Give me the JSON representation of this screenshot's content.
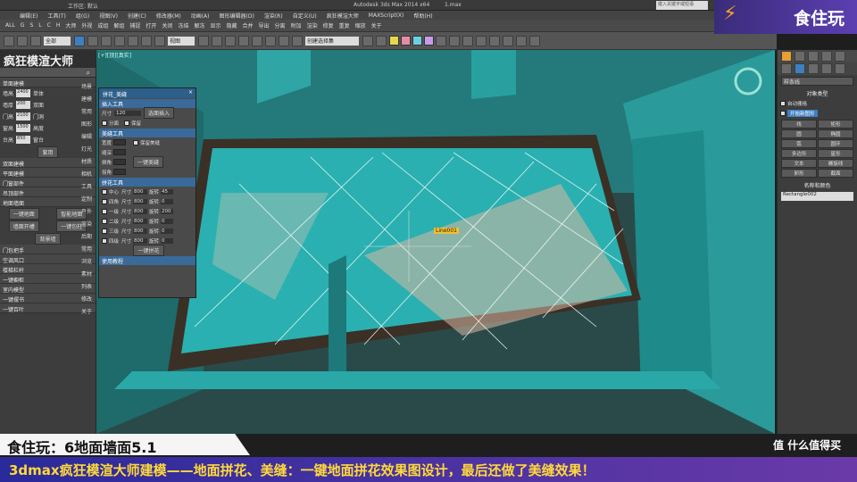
{
  "window": {
    "title": "Autodesk 3ds Max 2014 x64",
    "workspace": "工作区: 默认",
    "file": "1.max",
    "search_placeholder": "键入关键字或短语"
  },
  "menu": [
    "编辑(E)",
    "工具(T)",
    "组(G)",
    "视图(V)",
    "创建(C)",
    "修改器(M)",
    "动画(A)",
    "图形编辑器(D)",
    "渲染(R)",
    "自定义(U)",
    "疯狂模渲大师",
    "MAXScript(X)",
    "帮助(H)"
  ],
  "toolbar1": [
    "ALL",
    "G",
    "S",
    "L",
    "C",
    "H",
    "大师",
    "外视",
    "成组",
    "解组",
    "捕捉",
    "打开",
    "关闭",
    "冻结",
    "解冻",
    "显示",
    "隐藏",
    "合并",
    "导出",
    "分离",
    "附加",
    "渲染",
    "修复",
    "重复",
    "缩放",
    "关于"
  ],
  "toolbar2": {
    "selection_filter": "全部",
    "view": "视图",
    "named_set": "创建选择集"
  },
  "viewport": {
    "label": "[+][顶][真实]",
    "object_label": "Line001"
  },
  "left_panel": {
    "title": "疯狂模渲大师",
    "sections": [
      "单面建模",
      "双面建模",
      "平面建模",
      "门窗部件",
      "吊顶部件",
      "地面墙面",
      "门包把手",
      "空调风口",
      "楼梯栏杆",
      "一键橱柜",
      "室内模型",
      "一键摆书",
      "一键百叶"
    ],
    "fields": {
      "wall_h": "2400",
      "wall_h_label": "墙高",
      "thick": "200",
      "thick_label": "墙厚",
      "door_h": "2100",
      "door_h_label": "门高",
      "window_h": "1500",
      "window_h_label": "窗高",
      "sill": "850",
      "sill_label": "台高",
      "single": "单体",
      "double": "双面",
      "door": "门洞",
      "height": "高度",
      "sill_b": "窗台"
    },
    "apply_label": "套用",
    "buttons": [
      "一键地面",
      "智能地面",
      "墙面开槽",
      "一键包柱",
      "背景墙"
    ],
    "categories": [
      "场景",
      "建模",
      "常用",
      "图形",
      "编辑",
      "灯光",
      "材质",
      "相机",
      "工具",
      "定制",
      "户外",
      "渲染",
      "后期",
      "常用",
      "浏览",
      "素材",
      "列表",
      "修改",
      "关于"
    ]
  },
  "dialog": {
    "title": "拼花_美缝",
    "sec1": "插入工具",
    "wall_label": "尺寸",
    "wall_val": "120",
    "select_btn": "选面插入",
    "opt1": "分面",
    "opt2": "保留",
    "sec2": "美缝工具",
    "sec2_rows": [
      "宽度",
      "缝深",
      "倒角",
      "拐角"
    ],
    "keep": "保留美缝",
    "seam_btn": "一键美缝",
    "sec3": "拼花工具",
    "sec3_rows": [
      {
        "name": "中心",
        "size": "800",
        "rot": "45"
      },
      {
        "name": "四角",
        "size": "800",
        "rot": "0"
      },
      {
        "name": "一级",
        "size": "800",
        "rot": "200"
      },
      {
        "name": "二级",
        "size": "800",
        "rot": "0"
      },
      {
        "name": "三级",
        "size": "800",
        "rot": "0"
      },
      {
        "name": "四级",
        "size": "800",
        "rot": "0"
      }
    ],
    "size_label": "尺寸",
    "rot_label": "旋转",
    "pattern_btn": "一键拼花",
    "help": "使用教程"
  },
  "right_panel": {
    "dropdown": "样条线",
    "object_type": "对象类型",
    "auto_grid": "自动栅格",
    "start_new": "开始新图形",
    "shapes": [
      "线",
      "矩形",
      "圆",
      "椭圆",
      "弧",
      "圆环",
      "多边形",
      "星形",
      "文本",
      "螺旋线",
      "卵形",
      "截面"
    ],
    "name_color": "名称和颜色",
    "name_value": "Rectangle002"
  },
  "overlay": {
    "brand": "食住玩",
    "caption_top": "食住玩：6地面墙面5.1",
    "caption_bottom": "3dmax疯狂模渲大师建模——地面拼花、美缝：一键地面拼花效果图设计，最后还做了美缝效果！",
    "watermark": "值 什么值得买"
  },
  "colors": {
    "viewport_bg": "#2a4a4a",
    "teal": "#2aa8a8",
    "brand_purple": "#5b3fb0",
    "caption_yellow": "#ffd93a"
  }
}
